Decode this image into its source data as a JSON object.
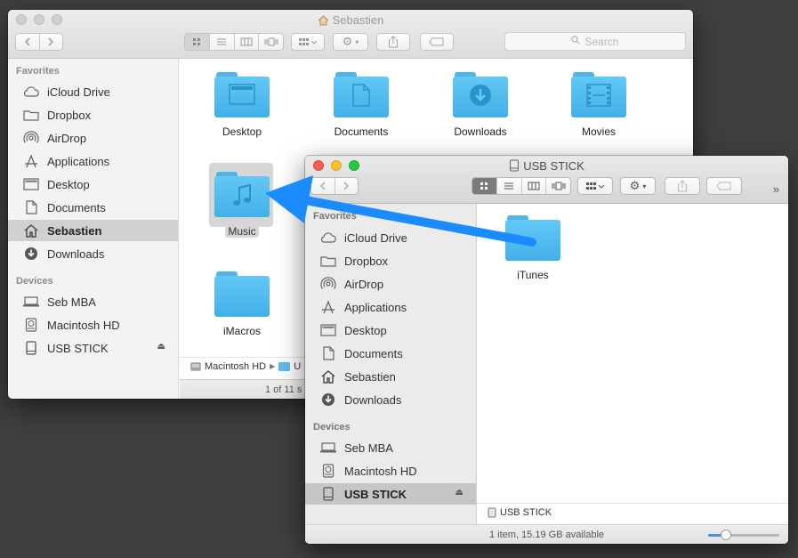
{
  "back_window": {
    "title": "Sebastien",
    "search_placeholder": "Search",
    "sidebar": {
      "favorites_heading": "Favorites",
      "favorites": [
        {
          "label": "iCloud Drive",
          "icon": "cloud-icon"
        },
        {
          "label": "Dropbox",
          "icon": "folder-icon"
        },
        {
          "label": "AirDrop",
          "icon": "airdrop-icon"
        },
        {
          "label": "Applications",
          "icon": "applications-icon"
        },
        {
          "label": "Desktop",
          "icon": "desktop-icon"
        },
        {
          "label": "Documents",
          "icon": "document-icon"
        },
        {
          "label": "Sebastien",
          "icon": "home-icon",
          "selected": true
        },
        {
          "label": "Downloads",
          "icon": "download-icon"
        }
      ],
      "devices_heading": "Devices",
      "devices": [
        {
          "label": "Seb MBA",
          "icon": "laptop-icon"
        },
        {
          "label": "Macintosh HD",
          "icon": "harddisk-icon"
        },
        {
          "label": "USB STICK",
          "icon": "usb-drive-icon",
          "eject": true
        }
      ]
    },
    "files": [
      {
        "label": "Desktop",
        "glyph": "desktop"
      },
      {
        "label": "Documents",
        "glyph": "document"
      },
      {
        "label": "Downloads",
        "glyph": "download"
      },
      {
        "label": "Movies",
        "glyph": "film"
      },
      {
        "label": "Music",
        "glyph": "music",
        "selected": true
      },
      {
        "label": "iMacros",
        "glyph": "none"
      }
    ],
    "pathbar": {
      "crumb1": "Macintosh HD",
      "crumb2": "U"
    },
    "status": "1 of 11 s"
  },
  "front_window": {
    "title": "USB STICK",
    "sidebar": {
      "favorites_heading": "Favorites",
      "favorites": [
        {
          "label": "iCloud Drive",
          "icon": "cloud-icon"
        },
        {
          "label": "Dropbox",
          "icon": "folder-icon"
        },
        {
          "label": "AirDrop",
          "icon": "airdrop-icon"
        },
        {
          "label": "Applications",
          "icon": "applications-icon"
        },
        {
          "label": "Desktop",
          "icon": "desktop-icon"
        },
        {
          "label": "Documents",
          "icon": "document-icon"
        },
        {
          "label": "Sebastien",
          "icon": "home-icon"
        },
        {
          "label": "Downloads",
          "icon": "download-icon"
        }
      ],
      "devices_heading": "Devices",
      "devices": [
        {
          "label": "Seb MBA",
          "icon": "laptop-icon"
        },
        {
          "label": "Macintosh HD",
          "icon": "harddisk-icon"
        },
        {
          "label": "USB STICK",
          "icon": "usb-drive-icon",
          "eject": true,
          "selected": true
        }
      ]
    },
    "files": [
      {
        "label": "iTunes",
        "glyph": "none"
      }
    ],
    "pathbar": {
      "crumb1": "USB STICK"
    },
    "status": "1 item, 15.19 GB available",
    "icon_size_slider": 0.25,
    "more_label": "»"
  },
  "accent": "#1a8cff"
}
